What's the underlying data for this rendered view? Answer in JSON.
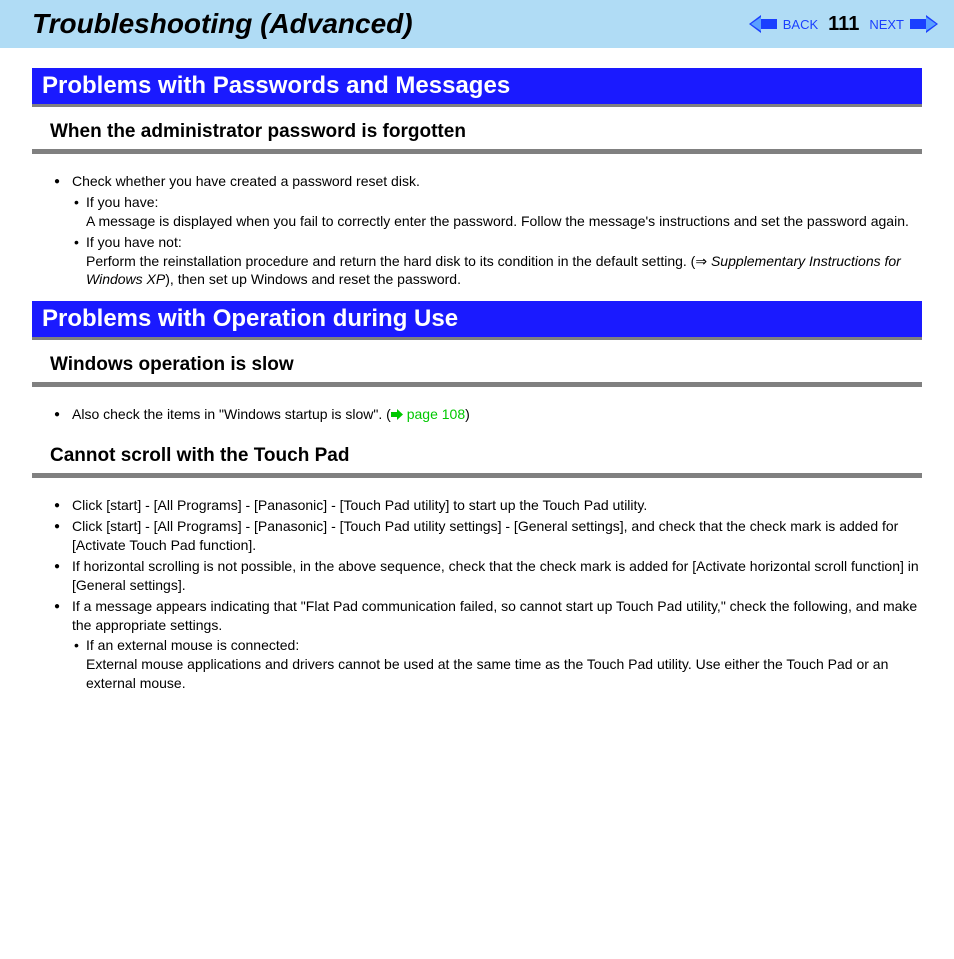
{
  "header": {
    "title": "Troubleshooting (Advanced)",
    "back": "BACK",
    "next": "NEXT",
    "page": "111"
  },
  "sections": {
    "passwords": {
      "title": "Problems with Passwords and Messages",
      "sub1": {
        "title": "When the administrator password is forgotten",
        "item1": "Check whether you have created a password reset disk.",
        "sub1_label": "If you have:",
        "sub1_text": "A message is displayed when you fail to correctly enter the password.  Follow the message's instructions and set the password again.",
        "sub2_label": "If you have not:",
        "sub2_text_a": "Perform the reinstallation procedure and return the hard disk to its condition in the default setting. (⇒ ",
        "sub2_text_italic": "Supplementary Instructions for Windows XP",
        "sub2_text_b": "), then set up Windows and reset the password."
      }
    },
    "operation": {
      "title": "Problems with Operation during Use",
      "sub1": {
        "title": "Windows operation is slow",
        "item1_a": "Also check the items in \"Windows startup is slow\". (",
        "item1_link": " page 108",
        "item1_b": ")"
      },
      "sub2": {
        "title": "Cannot scroll with the Touch Pad",
        "item1": "Click [start] - [All Programs] - [Panasonic] - [Touch Pad utility] to start up the Touch Pad utility.",
        "item2": "Click [start] - [All Programs] - [Panasonic] - [Touch Pad utility settings] - [General settings], and check that the check mark is added for [Activate Touch Pad function].",
        "item3": "If horizontal scrolling is not possible, in the above sequence, check that the check mark is added for [Activate horizontal scroll function] in [General settings].",
        "item4": "If a message appears indicating that \"Flat Pad communication failed, so cannot start up Touch Pad utility,\" check the following, and make the appropriate settings.",
        "sub1_label": "If an external mouse is connected:",
        "sub1_text": "External mouse applications and drivers cannot be used at the same time as the Touch Pad utility. Use either the Touch Pad or an external mouse."
      }
    }
  }
}
